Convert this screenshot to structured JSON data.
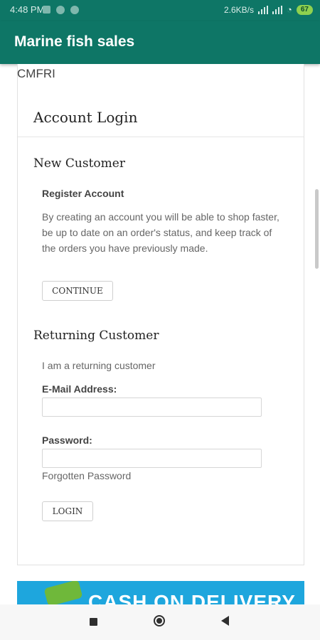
{
  "status_bar": {
    "time": "4:48 PM",
    "speed": "2.6KB/s",
    "battery": "67"
  },
  "app": {
    "title": "Marine fish sales"
  },
  "page": {
    "partial_text": "CMFRI",
    "account_login_title": "Account Login",
    "new_customer": {
      "heading": "New Customer",
      "register_label": "Register Account",
      "description": "By creating an account you will be able to shop faster, be up to date on an order's status, and keep track of the orders you have previously made.",
      "continue_label": "CONTINUE"
    },
    "returning_customer": {
      "heading": "Returning Customer",
      "subtext": "I am a returning customer",
      "email_label": "E-Mail Address:",
      "email_value": "",
      "password_label": "Password:",
      "password_value": "",
      "forgotten_label": "Forgotten Password",
      "login_label": "LOGIN"
    },
    "banner_text": "CASH ON DELIVERY"
  },
  "colors": {
    "app_bar": "#0e7666",
    "banner": "#1ea6dd"
  }
}
